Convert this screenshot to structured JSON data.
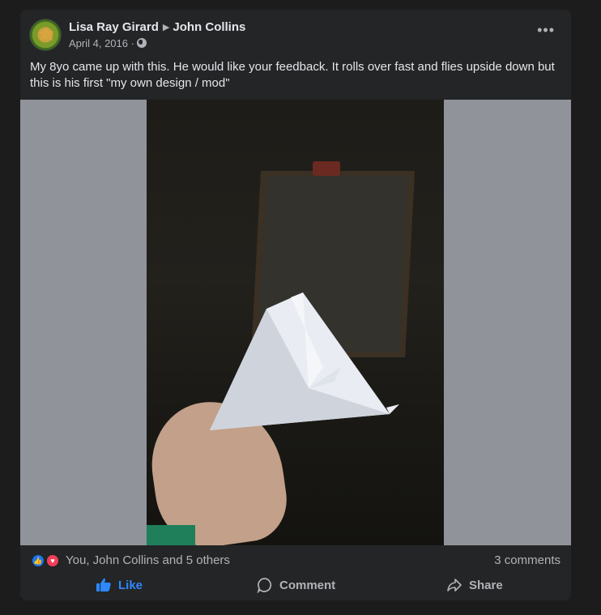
{
  "post": {
    "author": "Lisa Ray Girard",
    "target": "John Collins",
    "date": "April 4, 2016",
    "meta_sep": "·",
    "menu_label": "•••",
    "text": "My 8yo came up with this. He would like your feedback. It rolls over fast and flies upside down but this is his first \"my own design / mod\""
  },
  "reactions": {
    "summary": "You, John Collins and 5 others",
    "comments": "3 comments",
    "icons": [
      "thumbs-up-icon",
      "heart-icon"
    ]
  },
  "actions": {
    "like": "Like",
    "comment": "Comment",
    "share": "Share"
  },
  "colors": {
    "card": "#242526",
    "page": "#1c1c1d",
    "like_blue": "#2d88ff",
    "love_red": "#f33e58",
    "muted": "#b0b3b8"
  }
}
